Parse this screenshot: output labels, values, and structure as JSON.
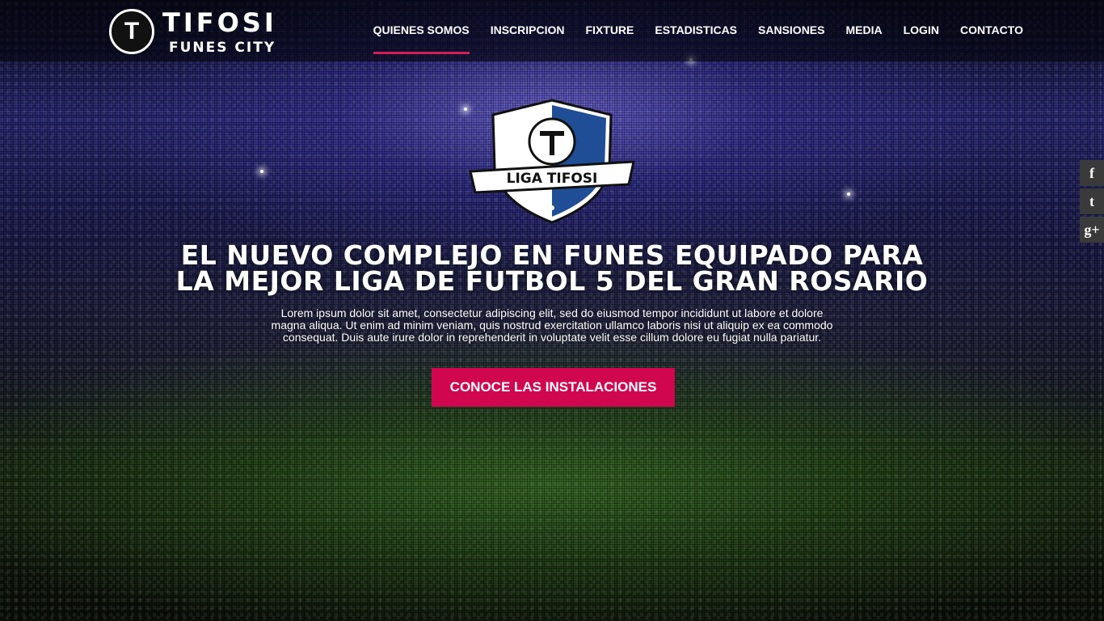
{
  "brand": {
    "title": "TIFOSI",
    "subtitle": "FUNES CITY",
    "badge_text": "LIGA TIFOSI"
  },
  "nav": {
    "items": [
      {
        "label": "QUIENES SOMOS",
        "active": true
      },
      {
        "label": "INSCRIPCION"
      },
      {
        "label": "FIXTURE"
      },
      {
        "label": "ESTADISTICAS"
      },
      {
        "label": "SANSIONES"
      },
      {
        "label": "MEDIA"
      },
      {
        "label": "LOGIN"
      },
      {
        "label": "CONTACTO"
      }
    ]
  },
  "hero": {
    "title_line1": "EL NUEVO COMPLEJO EN FUNES EQUIPADO PARA",
    "title_line2": "LA MEJOR LIGA DE FUTBOL 5 DEL GRAN ROSARIO",
    "text_line1": "Lorem ipsum dolor sit amet, consectetur adipiscing elit, sed do eiusmod tempor incididunt ut labore et dolore",
    "text_line2": "magna aliqua. Ut enim ad minim veniam, quis nostrud exercitation ullamco laboris nisi ut aliquip ex ea commodo",
    "text_line3": "consequat. Duis aute irure dolor in reprehenderit in voluptate velit esse cillum dolore eu fugiat nulla pariatur.",
    "cta_label": "CONOCE LAS INSTALACIONES"
  },
  "social": {
    "facebook": "f",
    "twitter": "t",
    "googleplus": "g+"
  },
  "colors": {
    "accent": "#d0064f",
    "nav_underline": "#d21f57",
    "badge_blue": "#1f4e96"
  }
}
